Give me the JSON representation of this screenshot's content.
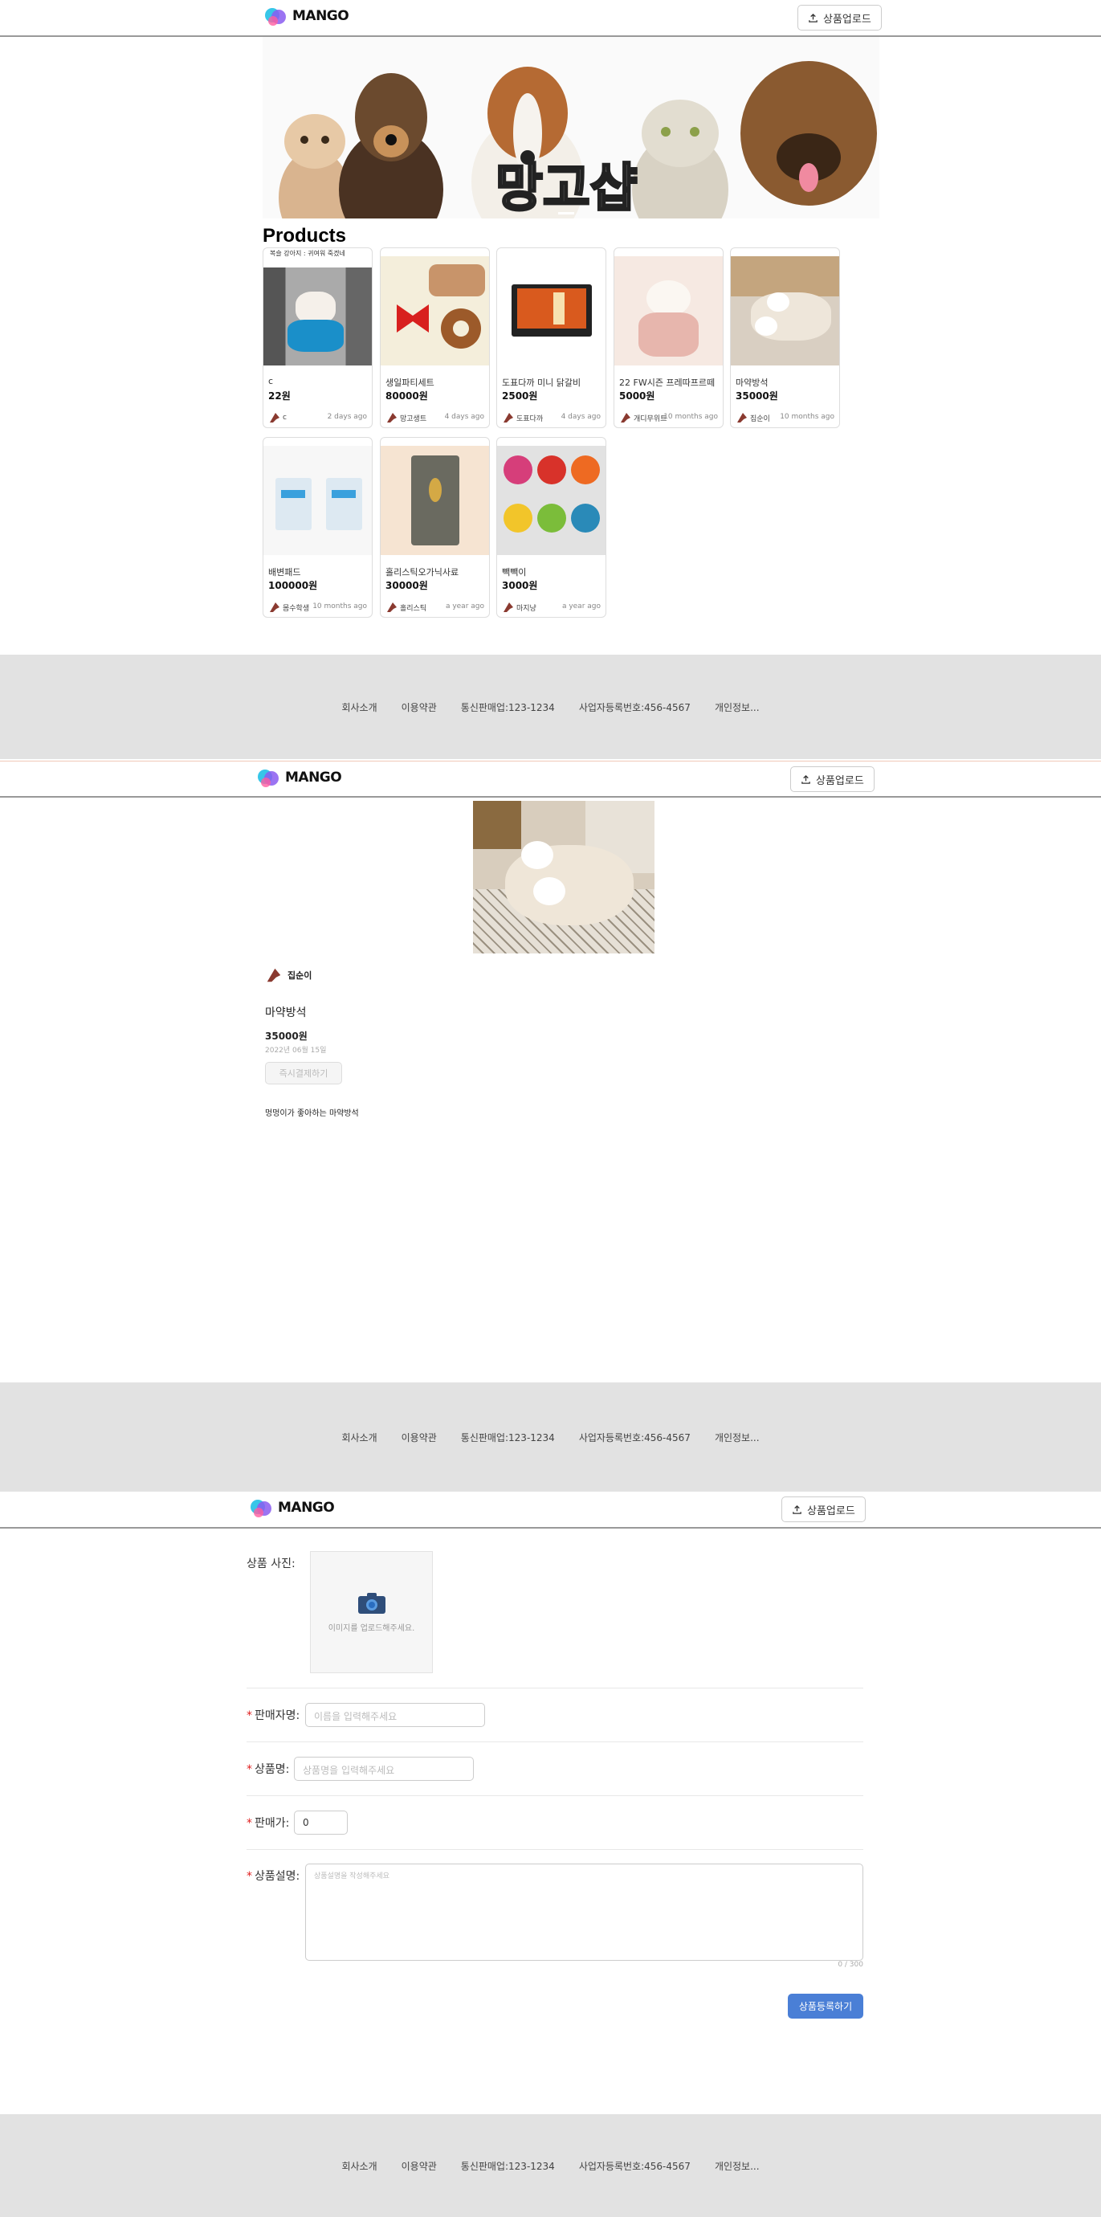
{
  "brand": {
    "logo_text": "MANGO"
  },
  "header": {
    "upload_label": "상품업로드"
  },
  "banner": {
    "text": "망고샵"
  },
  "products": {
    "title": "Products",
    "items": [
      {
        "name": "c",
        "price": "22원",
        "seller": "c",
        "date": "2 days ago",
        "caption": "복슬 강아지 : 귀여워 죽겠네"
      },
      {
        "name": "생일파티세트",
        "price": "80000원",
        "seller": "망고생트",
        "date": "4 days ago"
      },
      {
        "name": "도표다까 미니 닭갈비",
        "price": "2500원",
        "seller": "도표다까",
        "date": "4 days ago"
      },
      {
        "name": "22 FW시즌 프레따프르떼",
        "price": "5000원",
        "seller": "개디무위트",
        "date": "10 months ago"
      },
      {
        "name": "마약방석",
        "price": "35000원",
        "seller": "집순이",
        "date": "10 months ago"
      },
      {
        "name": "배변패드",
        "price": "100000원",
        "seller": "몸수학생",
        "date": "10 months ago"
      },
      {
        "name": "홀리스틱오가닉사료",
        "price": "30000원",
        "seller": "홀리스틱",
        "date": "a year ago"
      },
      {
        "name": "빽빽이",
        "price": "3000원",
        "seller": "마지냥",
        "date": "a year ago"
      }
    ]
  },
  "footer": {
    "links": [
      "회사소개",
      "이용약관",
      "통신판매업:123-1234",
      "사업자등록번호:456-4567",
      "개인정보..."
    ]
  },
  "detail": {
    "seller": "집순이",
    "name": "마약방석",
    "price": "35000원",
    "date": "2022년 06월 15일",
    "buy_label": "즉시결제하기",
    "description": "멍멍이가 좋아하는 마약방석"
  },
  "upload_form": {
    "photo_label": "상품 사진:",
    "photo_hint": "이미지를 업로드해주세요.",
    "seller_label": "판매자명:",
    "seller_placeholder": "이름을 입력해주세요",
    "name_label": "상품명:",
    "name_placeholder": "상품명을 입력해주세요",
    "price_label": "판매가:",
    "price_value": "0",
    "desc_label": "상품설명:",
    "desc_placeholder": "상품설명을 작성해주세요",
    "counter": "0 / 300",
    "submit_label": "상품등록하기"
  },
  "colors": {
    "accent": "#4a7fd6",
    "footer_bg": "#e2e2e2",
    "required": "#e02020"
  }
}
